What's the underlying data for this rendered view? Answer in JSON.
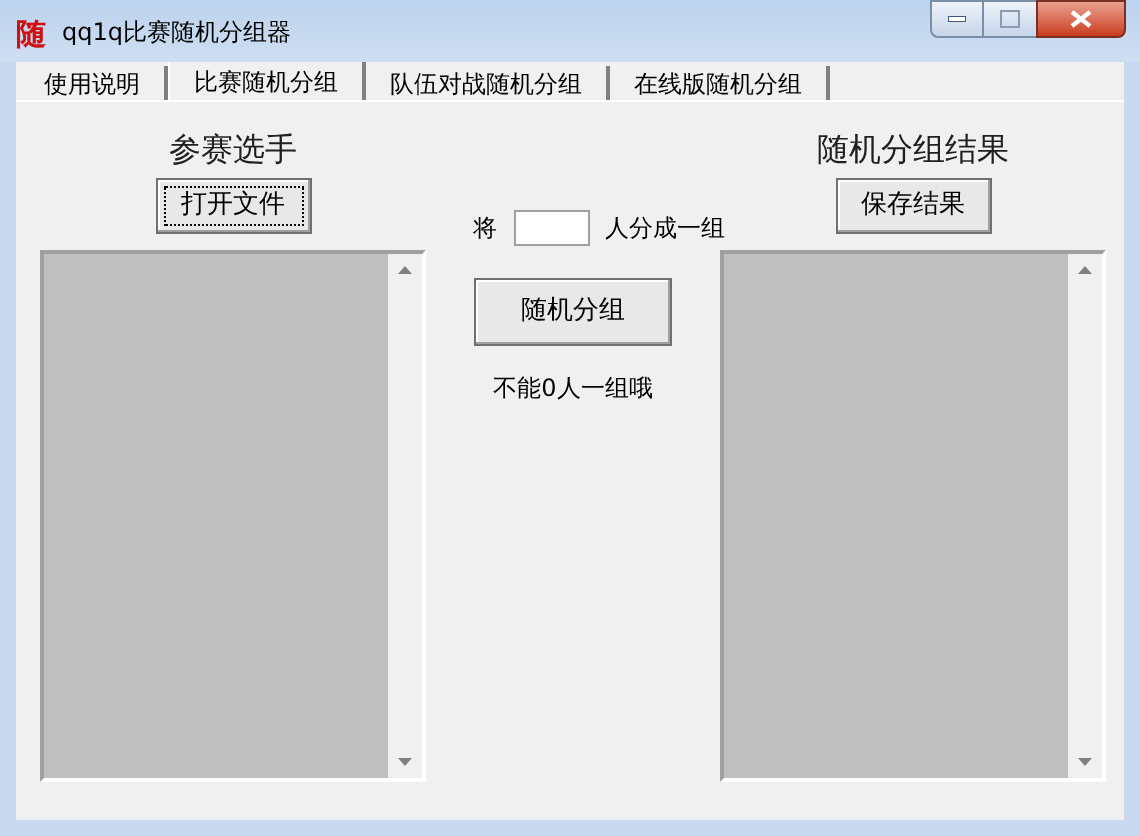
{
  "window": {
    "icon_char": "随",
    "title": "qq1q比赛随机分组器"
  },
  "tabs": [
    {
      "label": "使用说明",
      "selected": false
    },
    {
      "label": "比赛随机分组",
      "selected": true
    },
    {
      "label": "队伍对战随机分组",
      "selected": false
    },
    {
      "label": "在线版随机分组",
      "selected": false
    }
  ],
  "left": {
    "heading": "参赛选手",
    "button": "打开文件"
  },
  "middle": {
    "prefix": "将",
    "suffix": "人分成一组",
    "button": "随机分组",
    "note": "不能0人一组哦"
  },
  "right": {
    "heading": "随机分组结果",
    "button": "保存结果"
  }
}
